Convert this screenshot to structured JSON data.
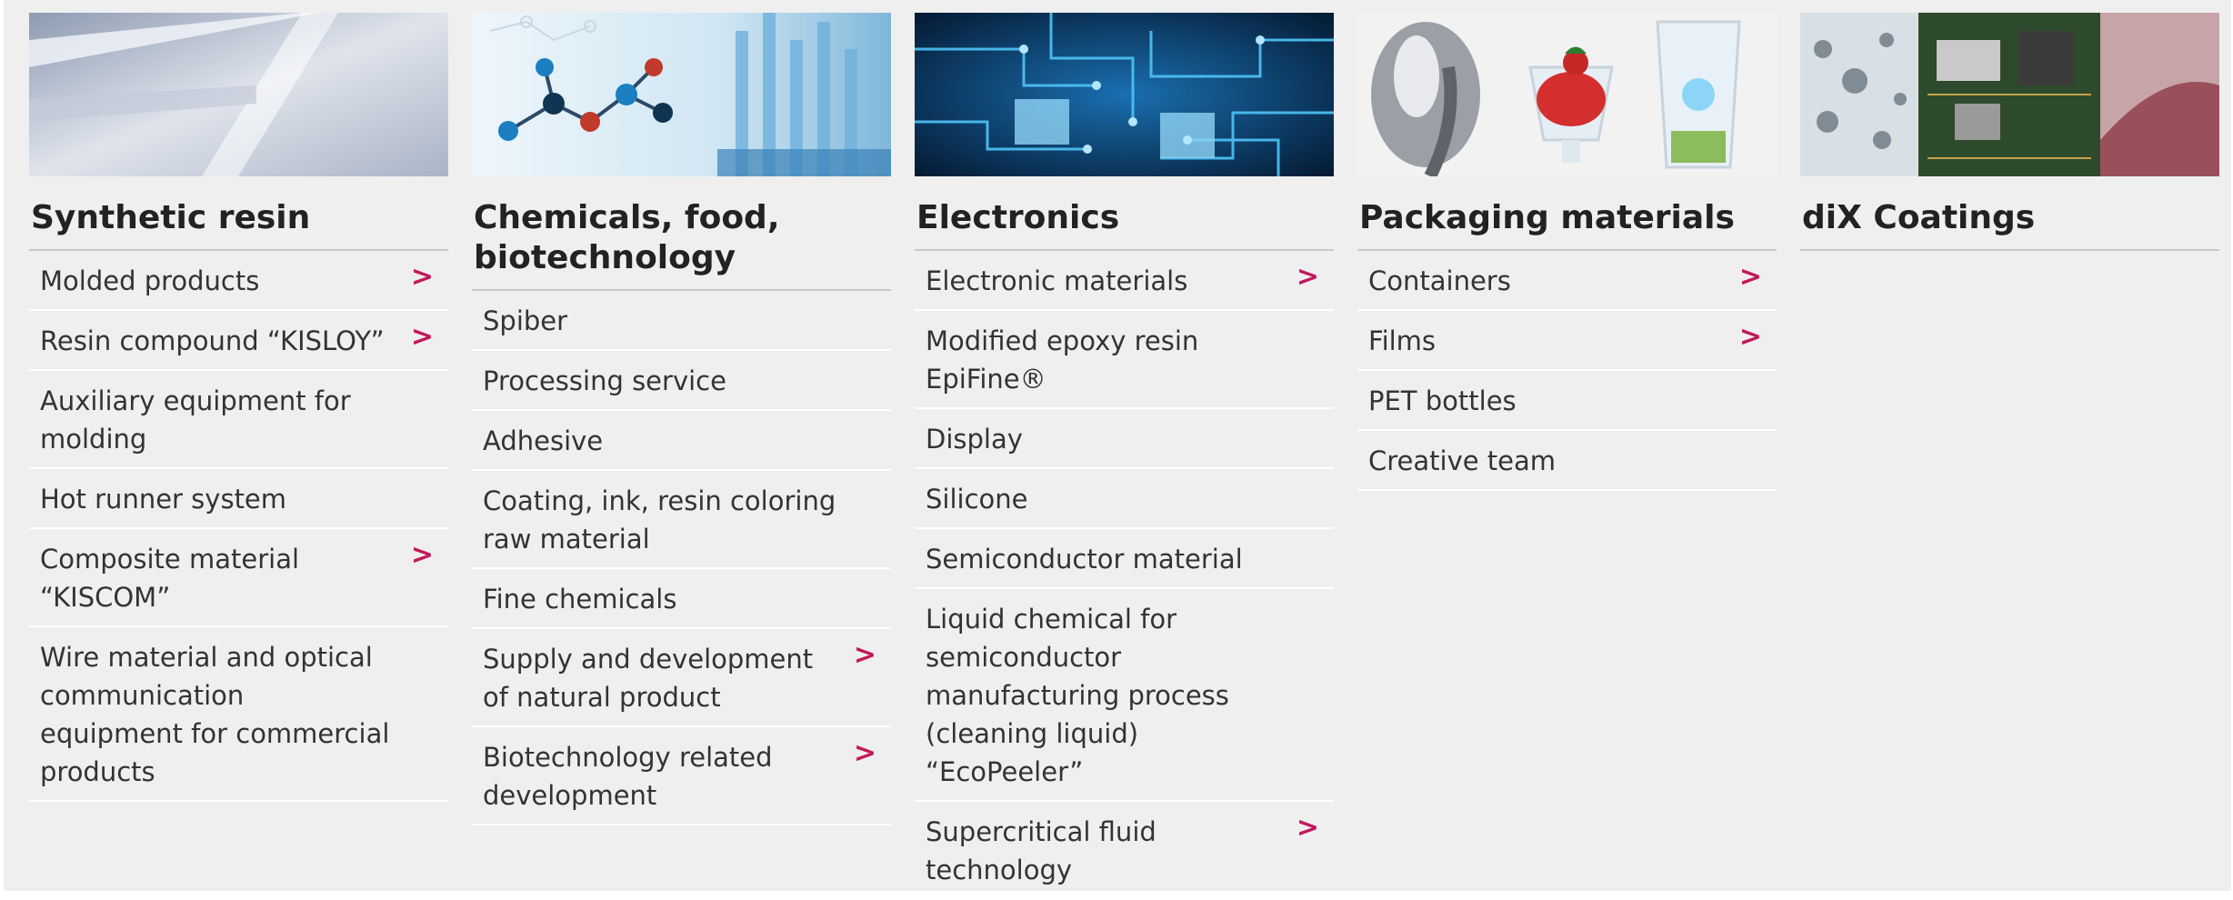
{
  "columns": [
    {
      "title": "Synthetic resin",
      "items": [
        {
          "label": "Molded products",
          "arrow": true
        },
        {
          "label": "Resin compound “KISLOY”",
          "arrow": true
        },
        {
          "label": "Auxiliary equipment for molding",
          "arrow": false
        },
        {
          "label": "Hot runner system",
          "arrow": false
        },
        {
          "label": "Composite material “KISCOM”",
          "arrow": true
        },
        {
          "label": "Wire material and optical communication equipment for commercial products",
          "arrow": false
        }
      ]
    },
    {
      "title": "Chemicals, food, biotechnology",
      "items": [
        {
          "label": "Spiber",
          "arrow": false
        },
        {
          "label": "Processing service",
          "arrow": false
        },
        {
          "label": "Adhesive",
          "arrow": false
        },
        {
          "label": "Coating, ink, resin coloring raw material",
          "arrow": false
        },
        {
          "label": "Fine chemicals",
          "arrow": false
        },
        {
          "label": "Supply and development of natural product",
          "arrow": true
        },
        {
          "label": "Biotechnology related development",
          "arrow": true
        }
      ]
    },
    {
      "title": "Electronics",
      "items": [
        {
          "label": "Electronic materials",
          "arrow": true
        },
        {
          "label": "Modified epoxy resin EpiFine®",
          "arrow": false
        },
        {
          "label": "Display",
          "arrow": false
        },
        {
          "label": "Silicone",
          "arrow": false
        },
        {
          "label": "Semiconductor material",
          "arrow": false
        },
        {
          "label": "Liquid chemical for semiconductor manufacturing process (cleaning liquid) “EcoPeeler”",
          "arrow": false
        },
        {
          "label": "Supercritical fluid technology",
          "arrow": true
        }
      ]
    },
    {
      "title": "Packaging materials",
      "items": [
        {
          "label": "Containers",
          "arrow": true
        },
        {
          "label": "Films",
          "arrow": true
        },
        {
          "label": "PET bottles",
          "arrow": false
        },
        {
          "label": "Creative team",
          "arrow": false
        }
      ]
    },
    {
      "title": "diX Coatings",
      "items": []
    }
  ],
  "arrow_glyph": ">",
  "colors": {
    "accent": "#c2185b",
    "panel": "#efefef"
  }
}
